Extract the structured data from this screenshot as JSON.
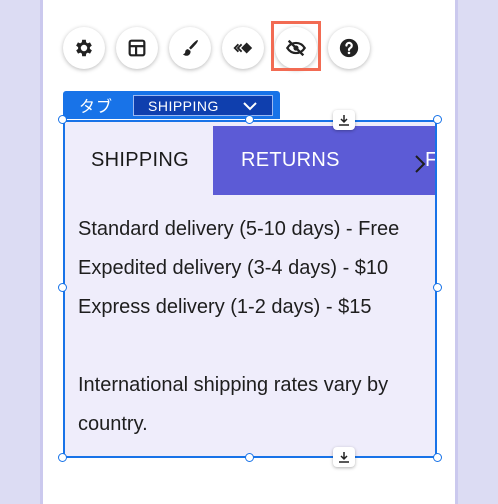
{
  "toolbar": {
    "buttons": [
      {
        "name": "settings-button",
        "icon": "gear-icon"
      },
      {
        "name": "layout-button",
        "icon": "layout-icon"
      },
      {
        "name": "design-button",
        "icon": "brush-icon"
      },
      {
        "name": "animation-button",
        "icon": "animation-icon"
      },
      {
        "name": "hide-button",
        "icon": "eye-off-icon",
        "highlighted": true
      },
      {
        "name": "help-button",
        "icon": "question-icon"
      }
    ],
    "highlight_color": "#f26b53"
  },
  "element_tag": {
    "label": "タブ",
    "selected_tab": "SHIPPING"
  },
  "tabs": {
    "items": [
      "SHIPPING",
      "RETURNS",
      "FA"
    ],
    "active_index": 0,
    "active_color": "#efedfb",
    "inactive_color": "#5c5bd6"
  },
  "content": {
    "lines": [
      "Standard delivery (5-10 days) - Free",
      "Expedited delivery (3-4 days) - $10",
      "Express delivery (1-2 days) - $15"
    ],
    "note_line1": "International shipping rates vary by",
    "note_line2": "country."
  },
  "colors": {
    "selection": "#1873e8",
    "select_bg": "#0f3fae"
  }
}
